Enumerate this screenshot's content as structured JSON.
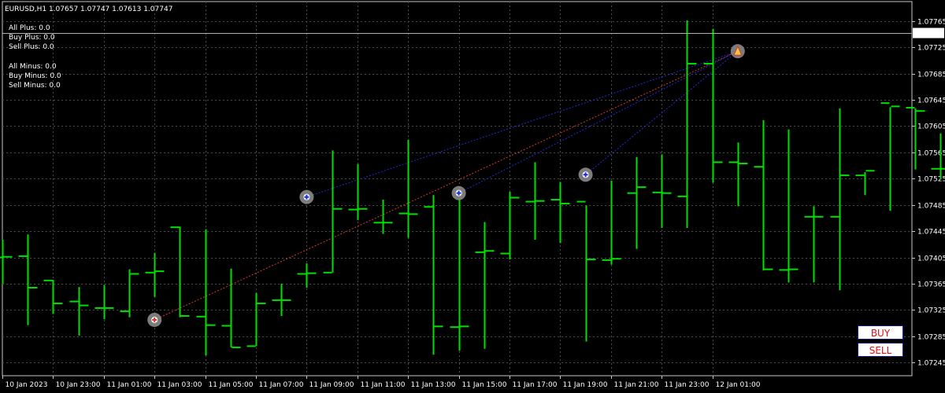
{
  "header": {
    "symbol_line": "EURUSD,H1  1.07657 1.07747 1.07613 1.07747"
  },
  "stats": {
    "all_plus": "All Plus: 0.0",
    "buy_plus": "Buy Plus: 0.0",
    "sell_plus": "Sell Plus: 0.0",
    "all_minus": "All Minus: 0.0",
    "buy_minus": "Buy Minus: 0.0",
    "sell_minus": "Sell Minus: 0.0"
  },
  "buttons": {
    "buy": "BUY",
    "sell": "SELL"
  },
  "colors": {
    "background": "#000000",
    "grid": "#4a4a4a",
    "bar": "#00e000",
    "bid_line": "#b0b0b0",
    "blue_link": "#1e2bd6",
    "red_link": "#d63a2a",
    "marker": "#8a8a8a"
  },
  "chart_data": {
    "type": "ohlc",
    "symbol": "EURUSD",
    "timeframe": "H1",
    "current_price": "1.07747",
    "ylim": [
      1.07225,
      1.07785
    ],
    "y_ticks": [
      "1.07765",
      "1.07725",
      "1.07685",
      "1.07645",
      "1.07605",
      "1.07565",
      "1.07525",
      "1.07485",
      "1.07445",
      "1.07405",
      "1.07365",
      "1.07325",
      "1.07285",
      "1.07245"
    ],
    "x_labels": [
      "10 Jan 2023",
      "10 Jan 23:00",
      "11 Jan 01:00",
      "11 Jan 03:00",
      "11 Jan 05:00",
      "11 Jan 07:00",
      "11 Jan 09:00",
      "11 Jan 11:00",
      "11 Jan 13:00",
      "11 Jan 15:00",
      "11 Jan 17:00",
      "11 Jan 19:00",
      "11 Jan 21:00",
      "11 Jan 23:00",
      "12 Jan 01:00"
    ],
    "bars": [
      {
        "o": 1.07405,
        "h": 1.07432,
        "l": 1.07365,
        "c": 1.07406
      },
      {
        "o": 1.07407,
        "h": 1.0744,
        "l": 1.07302,
        "c": 1.07359
      },
      {
        "o": 1.0737,
        "h": 1.07371,
        "l": 1.07319,
        "c": 1.07335
      },
      {
        "o": 1.07338,
        "h": 1.0736,
        "l": 1.07286,
        "c": 1.07332
      },
      {
        "o": 1.07328,
        "h": 1.07363,
        "l": 1.07311,
        "c": 1.07328
      },
      {
        "o": 1.07323,
        "h": 1.07387,
        "l": 1.07314,
        "c": 1.0738
      },
      {
        "o": 1.07382,
        "h": 1.07412,
        "l": 1.07345,
        "c": 1.07384
      },
      {
        "o": 1.07451,
        "h": 1.07452,
        "l": 1.07314,
        "c": 1.07316
      },
      {
        "o": 1.07315,
        "h": 1.07448,
        "l": 1.07256,
        "c": 1.07302
      },
      {
        "o": 1.07301,
        "h": 1.07388,
        "l": 1.07268,
        "c": 1.07268
      },
      {
        "o": 1.0727,
        "h": 1.07351,
        "l": 1.0727,
        "c": 1.07335
      },
      {
        "o": 1.0734,
        "h": 1.07365,
        "l": 1.07316,
        "c": 1.0734
      },
      {
        "o": 1.0738,
        "h": 1.07396,
        "l": 1.07359,
        "c": 1.07381
      },
      {
        "o": 1.07382,
        "h": 1.07568,
        "l": 1.07382,
        "c": 1.07479
      },
      {
        "o": 1.07478,
        "h": 1.07547,
        "l": 1.07462,
        "c": 1.07479
      },
      {
        "o": 1.07458,
        "h": 1.07493,
        "l": 1.07441,
        "c": 1.07458
      },
      {
        "o": 1.07472,
        "h": 1.07584,
        "l": 1.07435,
        "c": 1.07471
      },
      {
        "o": 1.07482,
        "h": 1.075,
        "l": 1.07257,
        "c": 1.073
      },
      {
        "o": 1.07299,
        "h": 1.07494,
        "l": 1.07263,
        "c": 1.073
      },
      {
        "o": 1.07413,
        "h": 1.07459,
        "l": 1.07266,
        "c": 1.07415
      },
      {
        "o": 1.07411,
        "h": 1.07505,
        "l": 1.07402,
        "c": 1.07496
      },
      {
        "o": 1.0749,
        "h": 1.0755,
        "l": 1.07432,
        "c": 1.07491
      },
      {
        "o": 1.07493,
        "h": 1.0752,
        "l": 1.07427,
        "c": 1.07487
      },
      {
        "o": 1.0749,
        "h": 1.07484,
        "l": 1.07277,
        "c": 1.07402
      },
      {
        "o": 1.07401,
        "h": 1.07522,
        "l": 1.07394,
        "c": 1.07403
      },
      {
        "o": 1.07503,
        "h": 1.07558,
        "l": 1.07418,
        "c": 1.07512
      },
      {
        "o": 1.07504,
        "h": 1.07562,
        "l": 1.0745,
        "c": 1.07503
      },
      {
        "o": 1.07498,
        "h": 1.07766,
        "l": 1.0745,
        "c": 1.077
      },
      {
        "o": 1.077,
        "h": 1.07753,
        "l": 1.07519,
        "c": 1.0755
      },
      {
        "o": 1.0755,
        "h": 1.0758,
        "l": 1.07483,
        "c": 1.07548
      },
      {
        "o": 1.07543,
        "h": 1.07614,
        "l": 1.07385,
        "c": 1.07387
      },
      {
        "o": 1.07386,
        "h": 1.076,
        "l": 1.07367,
        "c": 1.07387
      },
      {
        "o": 1.07467,
        "h": 1.07483,
        "l": 1.07367,
        "c": 1.07467
      },
      {
        "o": 1.07467,
        "h": 1.07632,
        "l": 1.07355,
        "c": 1.0753
      },
      {
        "o": 1.0753,
        "h": 1.07535,
        "l": 1.075,
        "c": 1.07537
      },
      {
        "o": 1.0764,
        "h": 1.07634,
        "l": 1.07476,
        "c": 1.07635
      },
      {
        "o": 1.07633,
        "h": 1.07632,
        "l": 1.07539,
        "c": 1.07628
      },
      {
        "o": 1.0754,
        "h": 1.07594,
        "l": 1.07524,
        "c": 1.0754
      },
      {
        "o": 1.07542,
        "h": 1.0758,
        "l": 1.07513,
        "c": 1.07545
      },
      {
        "o": 1.0756,
        "h": 1.07578,
        "l": 1.07517,
        "c": 1.0756
      },
      {
        "o": 1.07559,
        "h": 1.07588,
        "l": 1.07474,
        "c": 1.07546
      },
      {
        "o": 1.07557,
        "h": 1.07594,
        "l": 1.07524,
        "c": 1.07558
      },
      {
        "o": 1.07659,
        "h": 1.07668,
        "l": 1.07524,
        "c": 1.0766
      },
      {
        "o": 1.07657,
        "h": 1.07747,
        "l": 1.07613,
        "c": 1.07747
      }
    ],
    "markers": [
      {
        "bar": 6,
        "price": 1.0731,
        "kind": "sell"
      },
      {
        "bar": 12,
        "price": 1.07497,
        "kind": "buy"
      },
      {
        "bar": 18,
        "price": 1.07503,
        "kind": "buy"
      },
      {
        "bar": 23,
        "price": 1.07531,
        "kind": "buy"
      },
      {
        "bar": 29,
        "price": 1.07719,
        "kind": "target"
      }
    ]
  }
}
